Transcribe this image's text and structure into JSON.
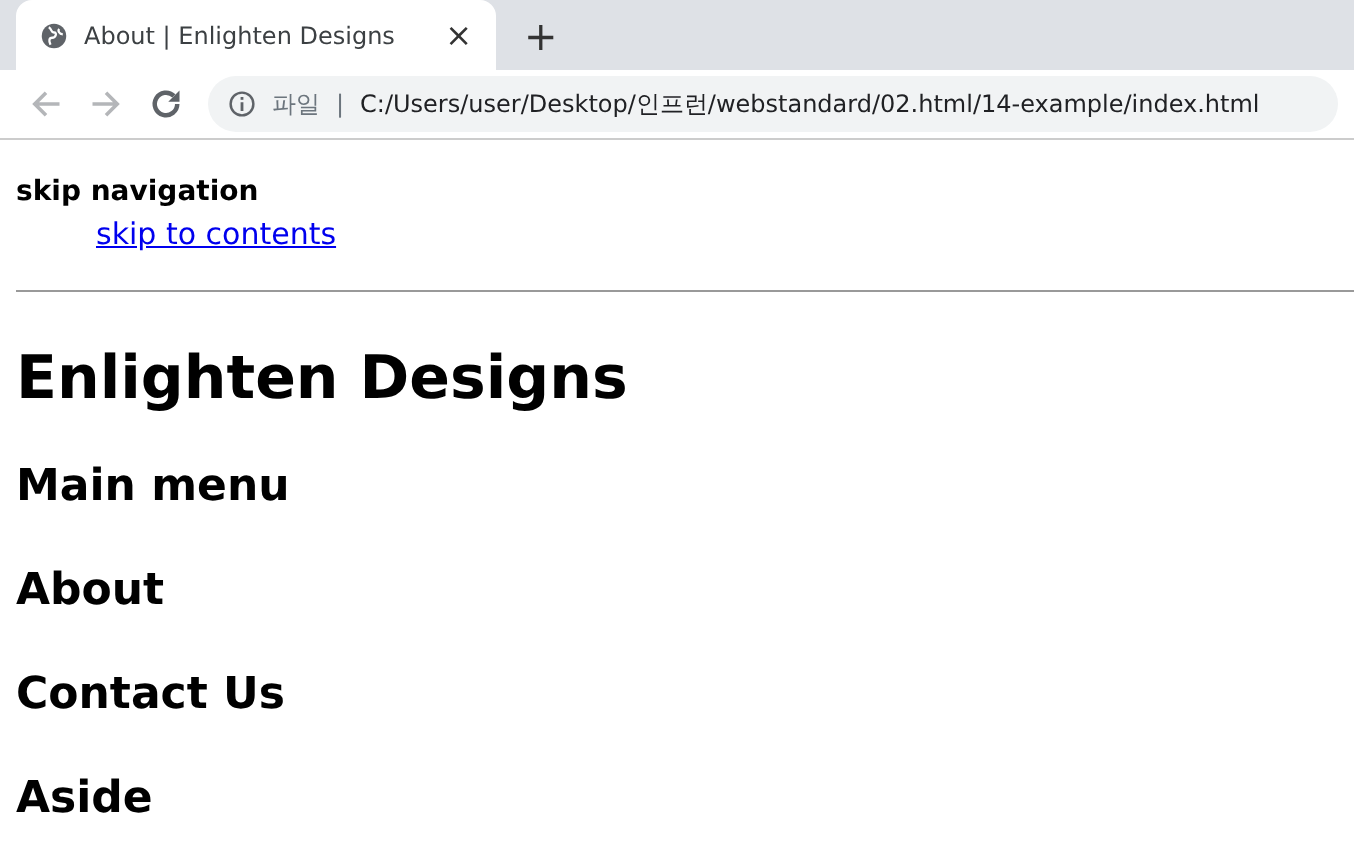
{
  "window": {
    "tab_title": "About | Enlighten Designs",
    "close_button": "×",
    "new_tab_button": "+"
  },
  "nav_buttons": [
    {
      "kind": "back",
      "disabled": true
    },
    {
      "kind": "forward",
      "disabled": true
    },
    {
      "kind": "reload",
      "disabled": false
    }
  ],
  "address_bar": {
    "scheme_label": "파일",
    "separator": "|",
    "url": "C:/Users/user/Desktop/인프런/webstandard/02.html/14-example/index.html"
  },
  "page": {
    "skip_heading": "skip navigation",
    "skip_link": "skip to contents",
    "title": "Enlighten Designs",
    "sections": [
      "Main menu",
      "About",
      "Contact Us",
      "Aside"
    ]
  }
}
